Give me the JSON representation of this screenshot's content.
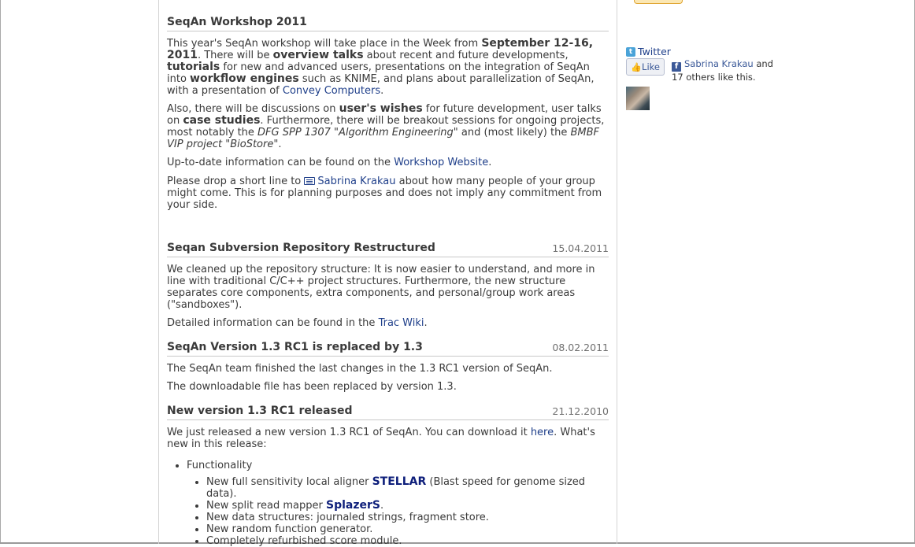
{
  "news": [
    {
      "title": "SeqAn Workshop 2011",
      "date": "",
      "p1": {
        "t1": "This year's SeqAn workshop will take place in the Week from ",
        "b1": "September 12-16, 2011",
        "t2": ". There will be ",
        "b2": "overview talks",
        "t3": " about recent and future developments, ",
        "b3": "tutorials",
        "t4": " for new and advanced users, presentations on the integration of SeqAn into ",
        "b4": "workflow engines",
        "t5": " such as KNIME, and plans about parallelization of SeqAn, with a presentation of ",
        "link": "Convey Computers",
        "t6": "."
      },
      "p2": {
        "t1": "Also, there will be discussions on ",
        "b1": "user's wishes",
        "t2": " for future development, user talks on ",
        "b2": "case studies",
        "t3": ". Furthermore, there will be breakout sessions for ongoing projects, most notably the ",
        "i1": "DFG SPP 1307 \"Algorithm Engineering\"",
        "t4": " and (most likely) the ",
        "i2": "BMBF VIP project \"BioStore\"",
        "t5": "."
      },
      "p3": {
        "t1": "Up-to-date information can be found on the ",
        "link": "Workshop Website",
        "t2": "."
      },
      "p4": {
        "t1": "Please drop a short line to ",
        "link": "Sabrina Krakau",
        "t2": " about how many people of your group might come. This is for planning purposes and does not imply any commitment from your side."
      }
    },
    {
      "title": "Seqan Subversion Repository Restructured",
      "date": "15.04.2011",
      "p1": "We cleaned up the repository structure: It is now easier to understand, and more in line with traditional C/C++ project structures. Furthermore, the new structure separates core components, extra components, and personal/group work areas (\"sandboxes\").",
      "p2": {
        "t1": "Detailed information can be found in the ",
        "link": "Trac Wiki",
        "t2": "."
      }
    },
    {
      "title": "SeqAn Version 1.3 RC1 is replaced by 1.3",
      "date": "08.02.2011",
      "p1": "The SeqAn team finished the last changes in the 1.3 RC1 version of SeqAn.",
      "p2": "The downloadable file has been replaced by version 1.3."
    },
    {
      "title": "New version 1.3 RC1 released",
      "date": "21.12.2010",
      "p1": {
        "t1": "We just released a new version 1.3 RC1 of SeqAn. You can download it ",
        "link": "here",
        "t2": ". What's new in this release:"
      },
      "list_heading": "Functionality",
      "items": [
        {
          "t1": "New full sensitivity local aligner ",
          "link": "STELLAR",
          "t2": " (Blast speed for genome sized data)."
        },
        {
          "t1": "New split read mapper ",
          "link": "SplazerS",
          "t2": "."
        },
        {
          "t1": "New data structures: journaled strings, fragment store.",
          "link": "",
          "t2": ""
        },
        {
          "t1": "New random function generator.",
          "link": "",
          "t2": ""
        },
        {
          "t1": "Completely refurbished score module.",
          "link": "",
          "t2": ""
        }
      ]
    }
  ],
  "sidebar": {
    "twitter_label": "Twitter",
    "like_label": "Like",
    "fb_name": "Sabrina Krakau",
    "fb_text_after_name": " and",
    "fb_text_line2": "17 others like this.",
    "fb_icon_glyph": "f",
    "twitter_icon_glyph": "t"
  },
  "colors": {
    "link": "#1f3f8a",
    "strong_link": "#0d1e7a",
    "heading": "#3a3a3a",
    "facebook": "#3b5998"
  }
}
